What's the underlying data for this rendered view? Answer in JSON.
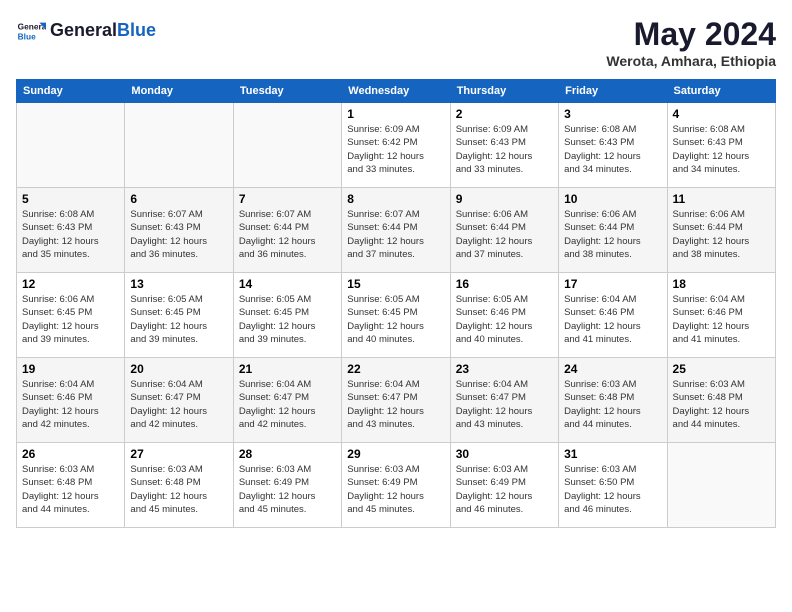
{
  "header": {
    "logo_line1": "General",
    "logo_line2": "Blue",
    "month_title": "May 2024",
    "subtitle": "Werota, Amhara, Ethiopia"
  },
  "days_of_week": [
    "Sunday",
    "Monday",
    "Tuesday",
    "Wednesday",
    "Thursday",
    "Friday",
    "Saturday"
  ],
  "weeks": [
    [
      {
        "day": "",
        "info": ""
      },
      {
        "day": "",
        "info": ""
      },
      {
        "day": "",
        "info": ""
      },
      {
        "day": "1",
        "info": "Sunrise: 6:09 AM\nSunset: 6:42 PM\nDaylight: 12 hours\nand 33 minutes."
      },
      {
        "day": "2",
        "info": "Sunrise: 6:09 AM\nSunset: 6:43 PM\nDaylight: 12 hours\nand 33 minutes."
      },
      {
        "day": "3",
        "info": "Sunrise: 6:08 AM\nSunset: 6:43 PM\nDaylight: 12 hours\nand 34 minutes."
      },
      {
        "day": "4",
        "info": "Sunrise: 6:08 AM\nSunset: 6:43 PM\nDaylight: 12 hours\nand 34 minutes."
      }
    ],
    [
      {
        "day": "5",
        "info": "Sunrise: 6:08 AM\nSunset: 6:43 PM\nDaylight: 12 hours\nand 35 minutes."
      },
      {
        "day": "6",
        "info": "Sunrise: 6:07 AM\nSunset: 6:43 PM\nDaylight: 12 hours\nand 36 minutes."
      },
      {
        "day": "7",
        "info": "Sunrise: 6:07 AM\nSunset: 6:44 PM\nDaylight: 12 hours\nand 36 minutes."
      },
      {
        "day": "8",
        "info": "Sunrise: 6:07 AM\nSunset: 6:44 PM\nDaylight: 12 hours\nand 37 minutes."
      },
      {
        "day": "9",
        "info": "Sunrise: 6:06 AM\nSunset: 6:44 PM\nDaylight: 12 hours\nand 37 minutes."
      },
      {
        "day": "10",
        "info": "Sunrise: 6:06 AM\nSunset: 6:44 PM\nDaylight: 12 hours\nand 38 minutes."
      },
      {
        "day": "11",
        "info": "Sunrise: 6:06 AM\nSunset: 6:44 PM\nDaylight: 12 hours\nand 38 minutes."
      }
    ],
    [
      {
        "day": "12",
        "info": "Sunrise: 6:06 AM\nSunset: 6:45 PM\nDaylight: 12 hours\nand 39 minutes."
      },
      {
        "day": "13",
        "info": "Sunrise: 6:05 AM\nSunset: 6:45 PM\nDaylight: 12 hours\nand 39 minutes."
      },
      {
        "day": "14",
        "info": "Sunrise: 6:05 AM\nSunset: 6:45 PM\nDaylight: 12 hours\nand 39 minutes."
      },
      {
        "day": "15",
        "info": "Sunrise: 6:05 AM\nSunset: 6:45 PM\nDaylight: 12 hours\nand 40 minutes."
      },
      {
        "day": "16",
        "info": "Sunrise: 6:05 AM\nSunset: 6:46 PM\nDaylight: 12 hours\nand 40 minutes."
      },
      {
        "day": "17",
        "info": "Sunrise: 6:04 AM\nSunset: 6:46 PM\nDaylight: 12 hours\nand 41 minutes."
      },
      {
        "day": "18",
        "info": "Sunrise: 6:04 AM\nSunset: 6:46 PM\nDaylight: 12 hours\nand 41 minutes."
      }
    ],
    [
      {
        "day": "19",
        "info": "Sunrise: 6:04 AM\nSunset: 6:46 PM\nDaylight: 12 hours\nand 42 minutes."
      },
      {
        "day": "20",
        "info": "Sunrise: 6:04 AM\nSunset: 6:47 PM\nDaylight: 12 hours\nand 42 minutes."
      },
      {
        "day": "21",
        "info": "Sunrise: 6:04 AM\nSunset: 6:47 PM\nDaylight: 12 hours\nand 42 minutes."
      },
      {
        "day": "22",
        "info": "Sunrise: 6:04 AM\nSunset: 6:47 PM\nDaylight: 12 hours\nand 43 minutes."
      },
      {
        "day": "23",
        "info": "Sunrise: 6:04 AM\nSunset: 6:47 PM\nDaylight: 12 hours\nand 43 minutes."
      },
      {
        "day": "24",
        "info": "Sunrise: 6:03 AM\nSunset: 6:48 PM\nDaylight: 12 hours\nand 44 minutes."
      },
      {
        "day": "25",
        "info": "Sunrise: 6:03 AM\nSunset: 6:48 PM\nDaylight: 12 hours\nand 44 minutes."
      }
    ],
    [
      {
        "day": "26",
        "info": "Sunrise: 6:03 AM\nSunset: 6:48 PM\nDaylight: 12 hours\nand 44 minutes."
      },
      {
        "day": "27",
        "info": "Sunrise: 6:03 AM\nSunset: 6:48 PM\nDaylight: 12 hours\nand 45 minutes."
      },
      {
        "day": "28",
        "info": "Sunrise: 6:03 AM\nSunset: 6:49 PM\nDaylight: 12 hours\nand 45 minutes."
      },
      {
        "day": "29",
        "info": "Sunrise: 6:03 AM\nSunset: 6:49 PM\nDaylight: 12 hours\nand 45 minutes."
      },
      {
        "day": "30",
        "info": "Sunrise: 6:03 AM\nSunset: 6:49 PM\nDaylight: 12 hours\nand 46 minutes."
      },
      {
        "day": "31",
        "info": "Sunrise: 6:03 AM\nSunset: 6:50 PM\nDaylight: 12 hours\nand 46 minutes."
      },
      {
        "day": "",
        "info": ""
      }
    ]
  ]
}
